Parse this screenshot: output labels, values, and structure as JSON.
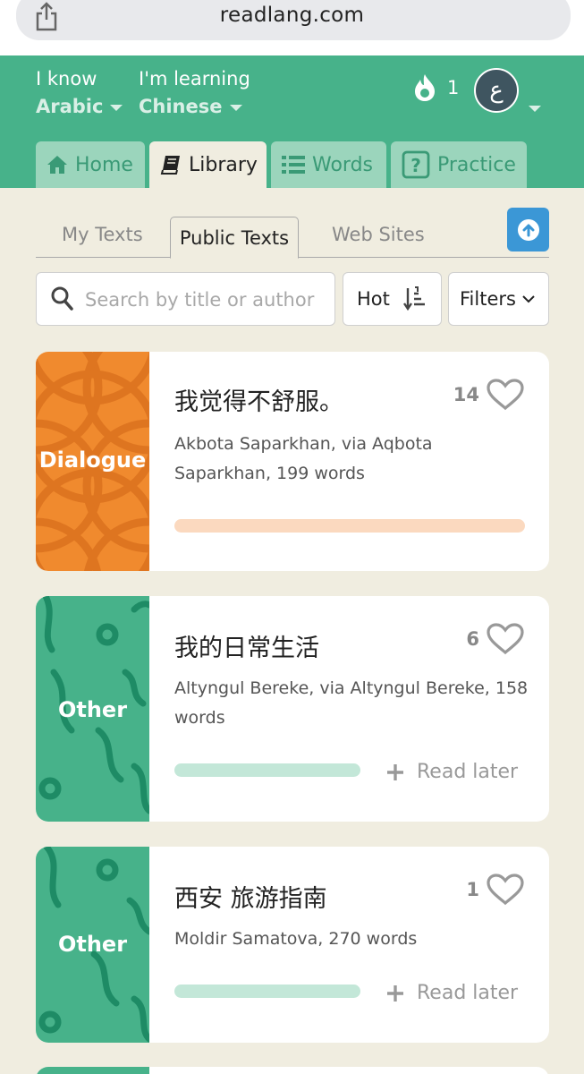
{
  "browser": {
    "url": "readlang.com"
  },
  "header": {
    "know_caption": "I know",
    "know_value": "Arabic",
    "learning_caption": "I'm learning",
    "learning_value": "Chinese",
    "streak_count": "1",
    "avatar_letter": "ع"
  },
  "nav": {
    "tabs": [
      {
        "label": "Home",
        "icon": "home-icon"
      },
      {
        "label": "Library",
        "icon": "book-icon"
      },
      {
        "label": "Words",
        "icon": "list-icon"
      },
      {
        "label": "Practice",
        "icon": "question-icon"
      }
    ],
    "active": "Library"
  },
  "subtabs": {
    "items": [
      "My Texts",
      "Public Texts",
      "Web Sites"
    ],
    "active": "Public Texts"
  },
  "search": {
    "placeholder": "Search by title or author"
  },
  "sort": {
    "label": "Hot"
  },
  "filters": {
    "label": "Filters"
  },
  "colors": {
    "brand_green": "#47b28a",
    "dialogue_orange": "#f08a2e",
    "upload_blue": "#3b97d6"
  },
  "cards": [
    {
      "category": "Dialogue",
      "title": "我觉得不舒服。",
      "likes": "14",
      "meta": "Akbota Saparkhan, via Aqbota Saparkhan, 199 words",
      "progress_color": "#fbd9bf",
      "read_later": ""
    },
    {
      "category": "Other",
      "title": "我的日常生活",
      "likes": "6",
      "meta": "Altyngul Bereke, via Altyngul Bereke, 158 words",
      "progress_color": "#c3e7d8",
      "read_later": "Read later"
    },
    {
      "category": "Other",
      "title": "西安 旅游指南",
      "likes": "1",
      "meta": "Moldir Samatova, 270 words",
      "progress_color": "#c3e7d8",
      "read_later": "Read later"
    }
  ]
}
